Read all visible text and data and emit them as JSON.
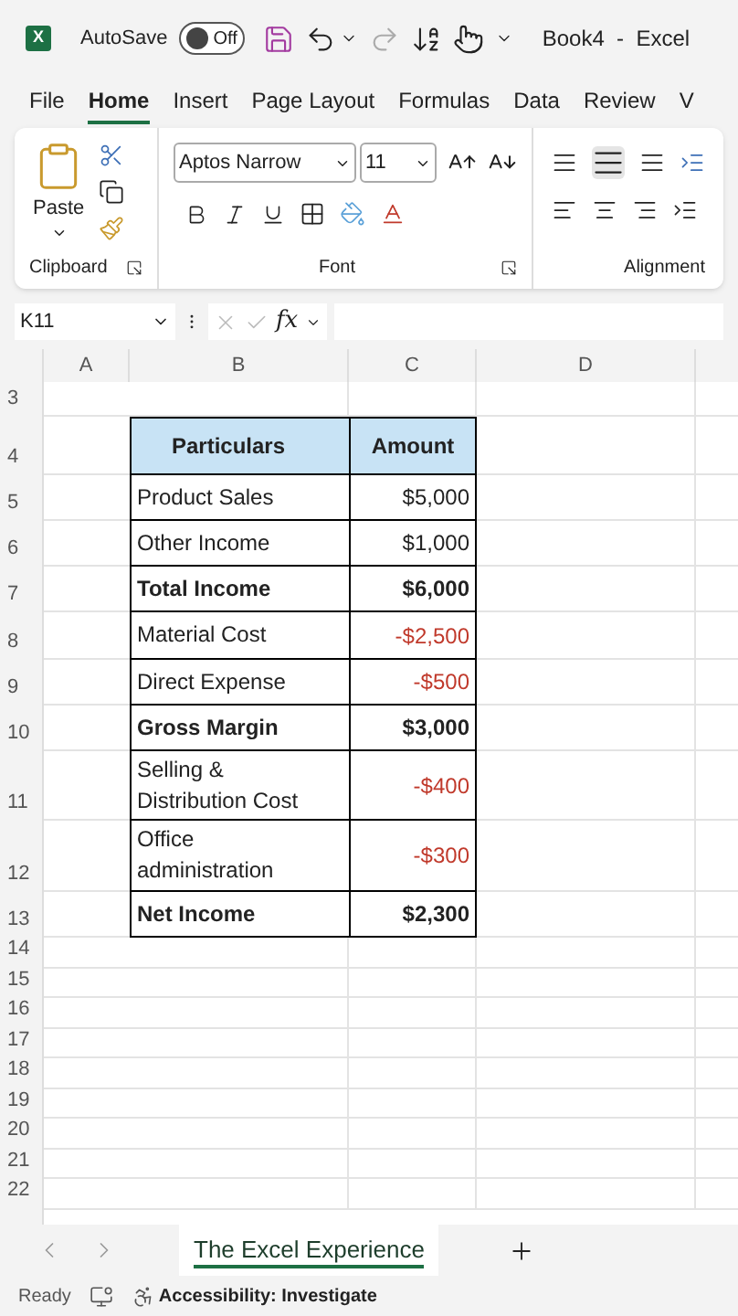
{
  "title_bar": {
    "app_icon_letter": "X",
    "autosave_label": "AutoSave",
    "autosave": {
      "on": false,
      "label": "Off"
    },
    "title": "Book4  -  Excel"
  },
  "menu_tabs": [
    {
      "label": "File",
      "selected": false
    },
    {
      "label": "Home",
      "selected": true
    },
    {
      "label": "Insert",
      "selected": false
    },
    {
      "label": "Page Layout",
      "selected": false
    },
    {
      "label": "Formulas",
      "selected": false
    },
    {
      "label": "Data",
      "selected": false
    },
    {
      "label": "Review",
      "selected": false
    },
    {
      "label": "V",
      "selected": false
    }
  ],
  "ribbon": {
    "paste_label": "Paste",
    "clipboard_label": "Clipboard",
    "font_name": "Aptos Narrow",
    "font_size": "11",
    "font_label": "Font",
    "alignment_label": "Alignment"
  },
  "formula_bar": {
    "name_box": "K11",
    "function_label": "fx"
  },
  "columns": [
    "A",
    "B",
    "C",
    "D"
  ],
  "row_numbers": [
    "3",
    "4",
    "5",
    "6",
    "7",
    "8",
    "9",
    "10",
    "11",
    "12",
    "13",
    "14",
    "15",
    "16",
    "17",
    "18",
    "19",
    "20",
    "21",
    "22"
  ],
  "table": {
    "columns": [
      "Particulars",
      "Amount"
    ],
    "rows": [
      {
        "particulars": "Product Sales",
        "amount": "$5,000",
        "bold": false,
        "negative": false
      },
      {
        "particulars": "Other Income",
        "amount": "$1,000",
        "bold": false,
        "negative": false
      },
      {
        "particulars": "Total Income",
        "amount": "$6,000",
        "bold": true,
        "negative": false
      },
      {
        "particulars": "Material Cost",
        "amount": "-$2,500",
        "bold": false,
        "negative": true
      },
      {
        "particulars": "Direct Expense",
        "amount": "-$500",
        "bold": false,
        "negative": true
      },
      {
        "particulars": "Gross Margin",
        "amount": "$3,000",
        "bold": true,
        "negative": false
      },
      {
        "particulars": "Selling & Distribution Cost",
        "amount": "-$400",
        "bold": false,
        "negative": true
      },
      {
        "particulars": "Office administration",
        "amount": "-$300",
        "bold": false,
        "negative": true
      },
      {
        "particulars": "Net Income",
        "amount": "$2,300",
        "bold": true,
        "negative": false
      }
    ]
  },
  "sheet_tabs": [
    {
      "label": "The Excel Experience",
      "selected": true
    }
  ],
  "status_bar": {
    "ready": "Ready",
    "accessibility": "Accessibility: Investigate"
  }
}
